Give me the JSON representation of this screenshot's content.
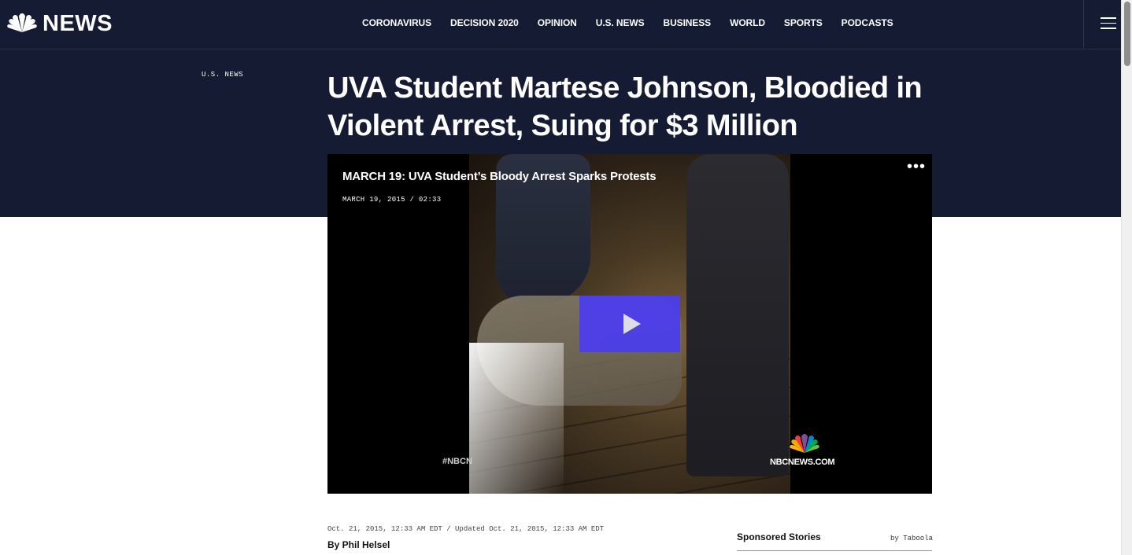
{
  "header": {
    "logo_text": "NEWS",
    "logo_icon": "peacock-icon",
    "nav": [
      {
        "label": "CORONAVIRUS"
      },
      {
        "label": "DECISION 2020"
      },
      {
        "label": "OPINION"
      },
      {
        "label": "U.S. NEWS"
      },
      {
        "label": "BUSINESS"
      },
      {
        "label": "WORLD"
      },
      {
        "label": "SPORTS"
      },
      {
        "label": "PODCASTS"
      }
    ],
    "menu_icon": "hamburger-icon"
  },
  "article": {
    "section": "U.S. NEWS",
    "headline": "UVA Student Martese Johnson, Bloodied in Violent Arrest, Suing for $3 Million",
    "dateline": "Oct. 21, 2015, 12:33 AM EDT / Updated Oct. 21, 2015, 12:33 AM EDT",
    "byline": "By Phil Helsel"
  },
  "video": {
    "title": "MARCH 19: UVA Student’s Bloody Arrest Sparks Protests",
    "meta": "MARCH 19, 2015 / 02:33",
    "more_icon": "more-dots-icon",
    "play_icon": "play-icon",
    "watermark_tag": "#NBCN",
    "watermark_site": "NBCNEWS.COM"
  },
  "sidebar": {
    "title": "Sponsored Stories",
    "provider": "by Taboola"
  },
  "colors": {
    "header_bg": "#141b32",
    "play_button": "#4b3df0"
  }
}
